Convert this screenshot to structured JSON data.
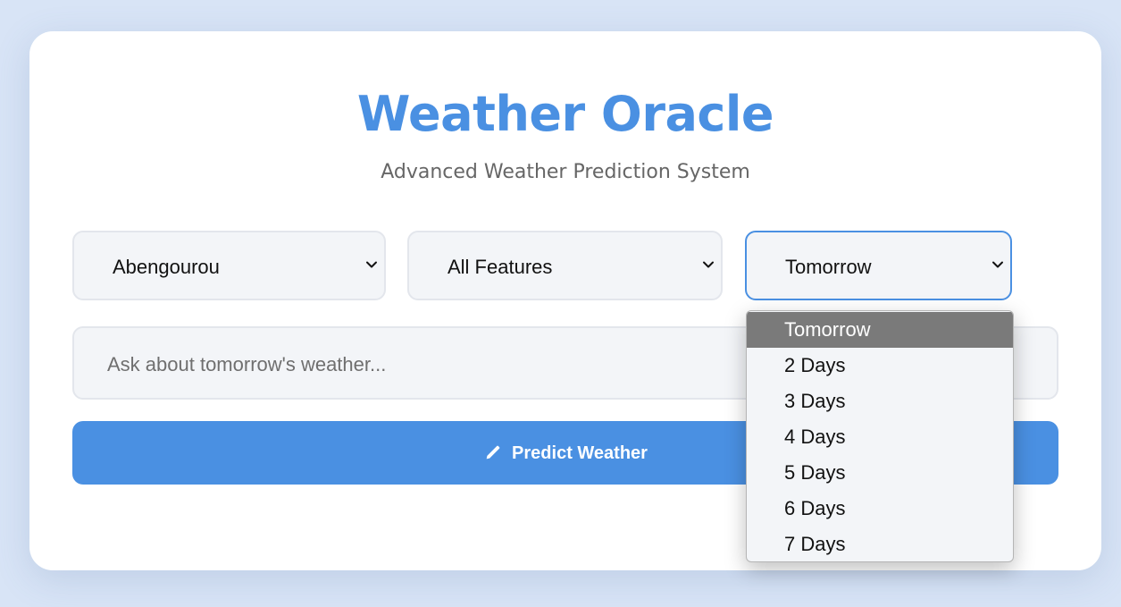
{
  "header": {
    "title": "Weather Oracle",
    "subtitle": "Advanced Weather Prediction System"
  },
  "selects": {
    "city": "Abengourou",
    "features": "All Features",
    "period": "Tomorrow"
  },
  "query": {
    "placeholder": "Ask about tomorrow's weather..."
  },
  "predict_button": {
    "label": "Predict Weather",
    "icon": "pencil-icon"
  },
  "period_dropdown": {
    "selected": "Tomorrow",
    "options": [
      "Tomorrow",
      "2 Days",
      "3 Days",
      "4 Days",
      "5 Days",
      "6 Days",
      "7 Days"
    ]
  },
  "colors": {
    "accent": "#4a90e2",
    "background": "#d8e4f6",
    "option_highlight": "#7a7a7a"
  }
}
